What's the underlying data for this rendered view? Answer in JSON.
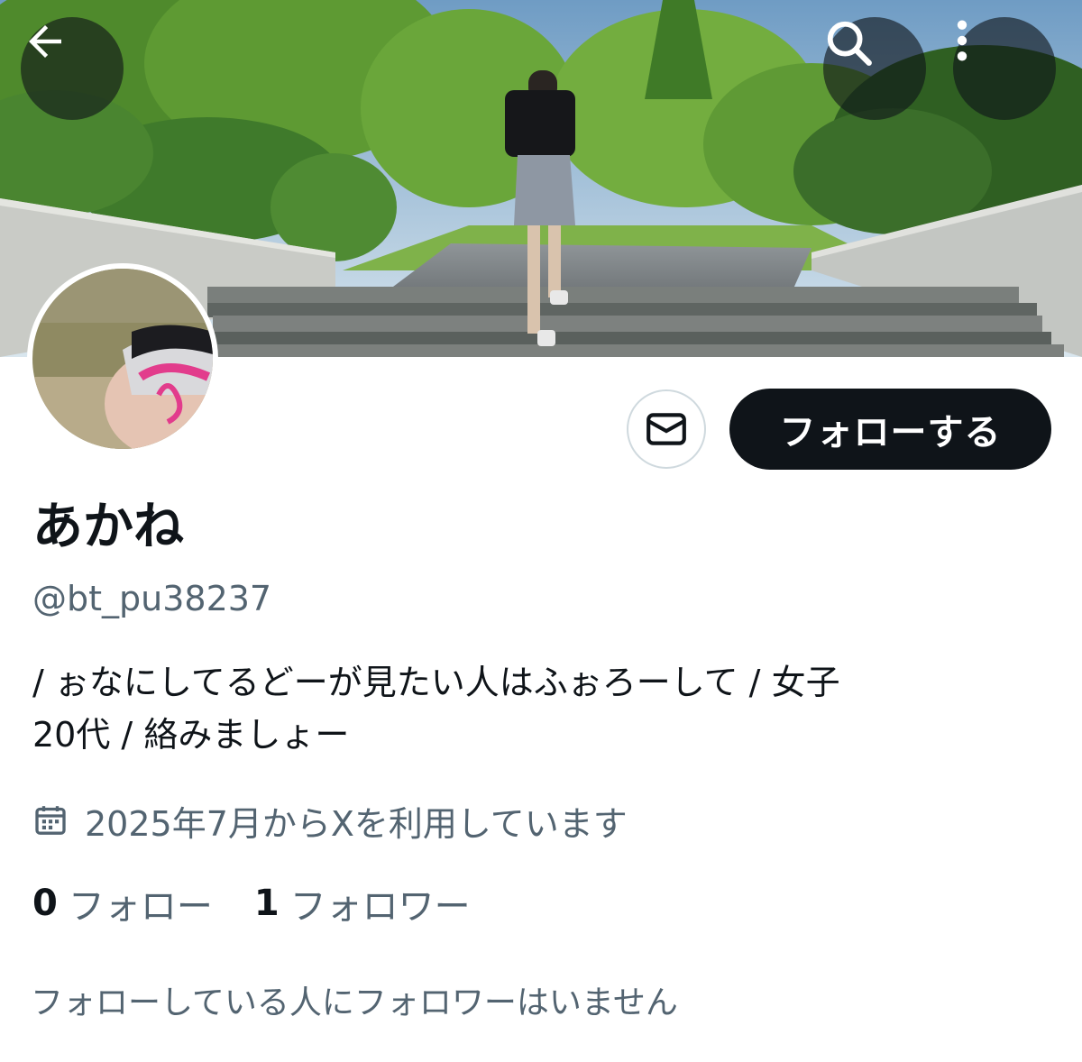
{
  "header": {
    "back_icon": "arrow-left-icon",
    "search_icon": "search-icon",
    "more_icon": "more-vertical-icon"
  },
  "profile": {
    "display_name": "あかね",
    "handle": "@bt_pu38237",
    "bio_line1": "/ ぉなにしてるどーが見たい人はふぉろーして / 女子",
    "bio_line2": "20代  / 絡みましょー",
    "joined": "2025年7月からXを利用しています",
    "joined_icon": "calendar-icon"
  },
  "actions": {
    "message_icon": "envelope-icon",
    "follow_label": "フォローする"
  },
  "stats": {
    "following_count": "0",
    "following_label": "フォロー",
    "followers_count": "1",
    "followers_label": "フォロワー"
  },
  "mutuals_text": "フォローしている人にフォロワーはいません",
  "colors": {
    "text_primary": "#0f1419",
    "text_secondary": "#536471",
    "follow_button_bg": "#0f1419",
    "border": "#cfd9de"
  }
}
